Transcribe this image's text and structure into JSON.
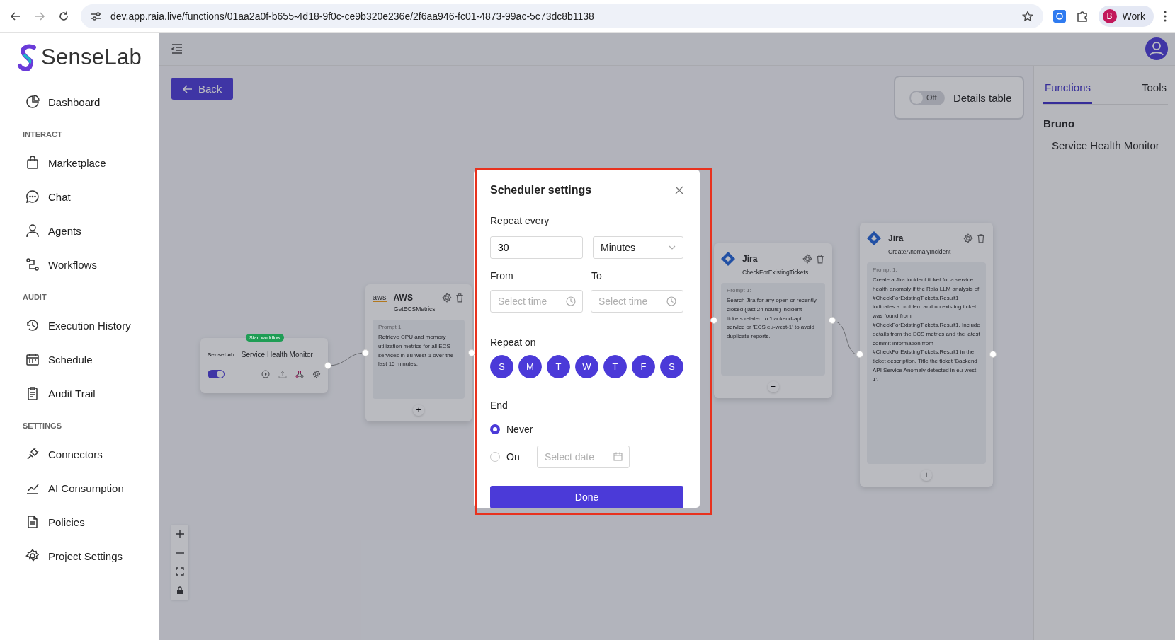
{
  "browser": {
    "url": "dev.app.raia.live/functions/01aa2a0f-b655-4d18-9f0c-ce9b320e236e/2f6aa946-fc01-4873-99ac-5c73dc8b1138",
    "profile_initial": "B",
    "profile_label": "Work"
  },
  "sidebar": {
    "logo": "SenseLab",
    "entries": [
      {
        "kind": "item",
        "label": "Dashboard"
      },
      {
        "kind": "heading",
        "label": "INTERACT"
      },
      {
        "kind": "item",
        "label": "Marketplace"
      },
      {
        "kind": "item",
        "label": "Chat"
      },
      {
        "kind": "item",
        "label": "Agents"
      },
      {
        "kind": "item",
        "label": "Workflows"
      },
      {
        "kind": "heading",
        "label": "AUDIT"
      },
      {
        "kind": "item",
        "label": "Execution History"
      },
      {
        "kind": "item",
        "label": "Schedule"
      },
      {
        "kind": "item",
        "label": "Audit Trail"
      },
      {
        "kind": "heading",
        "label": "SETTINGS"
      },
      {
        "kind": "item",
        "label": "Connectors"
      },
      {
        "kind": "item",
        "label": "AI Consumption"
      },
      {
        "kind": "item",
        "label": "Policies"
      },
      {
        "kind": "item",
        "label": "Project Settings"
      }
    ]
  },
  "toolbar": {
    "back_button": "Back",
    "details_toggle": {
      "on": false,
      "label": "Off",
      "text": "Details table"
    }
  },
  "right_panel": {
    "tabs": [
      {
        "label": "Functions",
        "selected": true
      },
      {
        "label": "Tools",
        "selected": false
      }
    ],
    "group": "Bruno",
    "items": [
      "Service Health Monitor"
    ]
  },
  "canvas": {
    "start_node": {
      "badge": "Start workflow",
      "logo": "SenseLab",
      "title": "Service Health Monitor",
      "enabled": true
    },
    "nodes": [
      {
        "kind": "aws",
        "logo": "aws",
        "app": "AWS",
        "function": "GetECSMetrics",
        "prompt_label": "Prompt 1:",
        "prompt": "Retrieve CPU and memory utilization metrics for all ECS services in eu-west-1 over the last 15 minutes.",
        "add": "+"
      },
      {
        "kind": "jira",
        "app": "Jira",
        "function": "CheckForExistingTickets",
        "prompt_label": "Prompt 1:",
        "prompt": "Search Jira for any open or recently closed (last 24 hours) incident tickets related to 'backend-api' service or 'ECS eu-west-1' to avoid duplicate reports.",
        "add": "+"
      },
      {
        "kind": "jira",
        "app": "Jira",
        "function": "CreateAnomalyIncident",
        "prompt_label": "Prompt 1:",
        "prompt": "Create a Jira incident ticket for a service health anomaly if the Raia LLM analysis of #CheckForExistingTickets.Result1 indicates a problem and no existing ticket was found from #CheckForExistingTickets.Result1. Include details from the ECS metrics and the latest commit information from #CheckForExistingTickets.Result1 in the ticket description. Title the ticket 'Backend API Service Anomaly detected in eu-west-1'.",
        "add": "+"
      }
    ]
  },
  "modal": {
    "title": "Scheduler settings",
    "repeat_label": "Repeat every",
    "interval": "30",
    "unit": "Minutes",
    "from_label": "From",
    "to_label": "To",
    "from_placeholder": "Select time",
    "to_placeholder": "Select time",
    "repeat_on_label": "Repeat on",
    "days": [
      {
        "label": "S",
        "selected": true
      },
      {
        "label": "M",
        "selected": true
      },
      {
        "label": "T",
        "selected": true
      },
      {
        "label": "W",
        "selected": true
      },
      {
        "label": "T",
        "selected": true
      },
      {
        "label": "F",
        "selected": true
      },
      {
        "label": "S",
        "selected": true
      }
    ],
    "end_label": "End",
    "end_options": [
      {
        "kind": "never",
        "label": "Never",
        "selected": true
      },
      {
        "kind": "date",
        "label": "On",
        "selected": false,
        "placeholder": "Select date"
      }
    ],
    "done_button": "Done"
  }
}
